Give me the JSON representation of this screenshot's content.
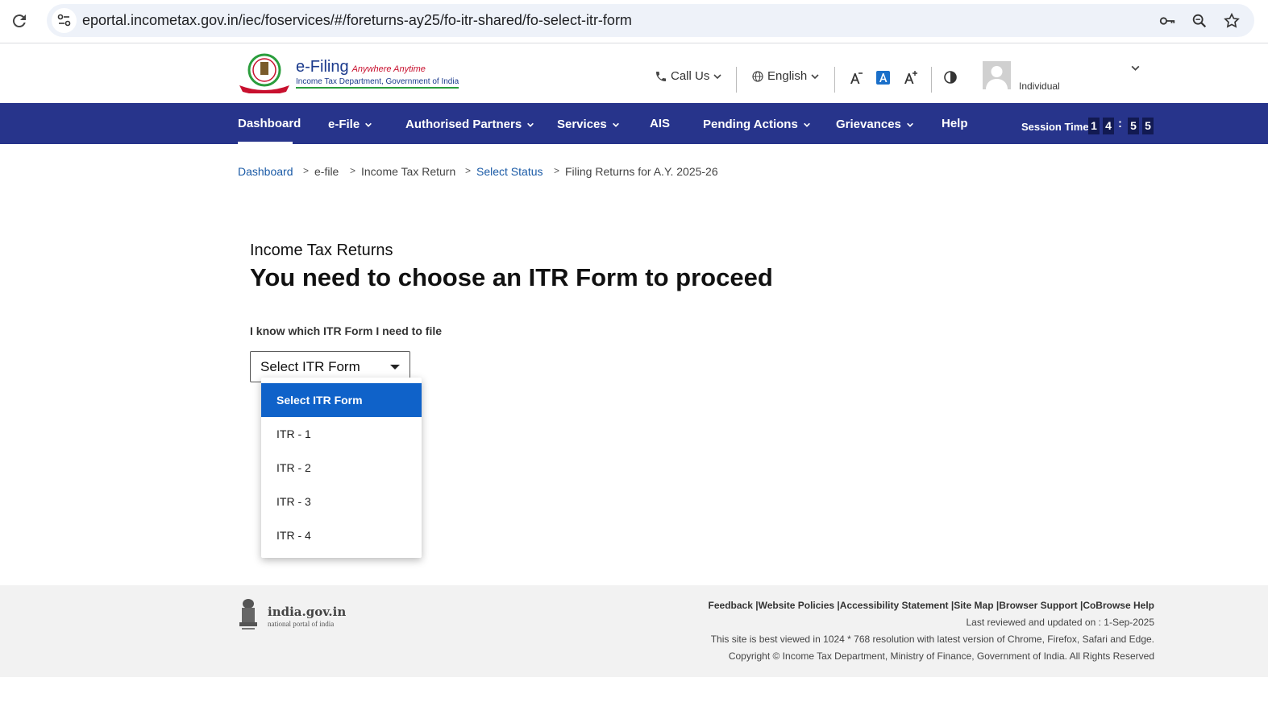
{
  "browser": {
    "url": "eportal.incometax.gov.in/iec/foservices/#/foreturns-ay25/fo-itr-shared/fo-select-itr-form"
  },
  "header": {
    "logo_title": "e-Filing",
    "logo_tagline": "Anywhere Anytime",
    "logo_subtitle": "Income Tax Department, Government of India",
    "call_us": "Call Us",
    "language": "English",
    "user_type": "Individual"
  },
  "nav": {
    "items": [
      "Dashboard",
      "e-File",
      "Authorised Partners",
      "Services",
      "AIS",
      "Pending Actions",
      "Grievances",
      "Help"
    ],
    "session_label": "Session Time",
    "session_digits": [
      "1",
      "4",
      "5",
      "5"
    ],
    "session_colon": ":"
  },
  "breadcrumb": {
    "items": [
      "Dashboard",
      "e-file",
      "Income Tax Return",
      "Select Status",
      "Filing Returns for A.Y. 2025-26"
    ],
    "separator": ">"
  },
  "main": {
    "subtitle": "Income Tax Returns",
    "title": "You need to choose an ITR Form to proceed",
    "field_label": "I know which ITR Form I need to file",
    "select_value": "Select ITR Form",
    "options": [
      "Select ITR Form",
      "ITR - 1",
      "ITR - 2",
      "ITR - 3",
      "ITR - 4"
    ]
  },
  "footer": {
    "india_gov": "india.gov.in",
    "india_gov_sub": "national portal of india",
    "links": [
      "Feedback",
      "Website Policies",
      "Accessibility Statement",
      "Site Map",
      "Browser Support",
      "CoBrowse Help"
    ],
    "link_separator": " |",
    "last_reviewed": "Last reviewed and updated on : 1-Sep-2025",
    "best_viewed": "This site is best viewed in 1024 * 768 resolution with latest version of Chrome, Firefox, Safari and Edge.",
    "copyright": "Copyright © Income Tax Department, Ministry of Finance, Government of India. All Rights Reserved"
  },
  "colors": {
    "nav_bg": "#27348b",
    "link": "#1a5aa6",
    "option_selected": "#0f62c9"
  }
}
